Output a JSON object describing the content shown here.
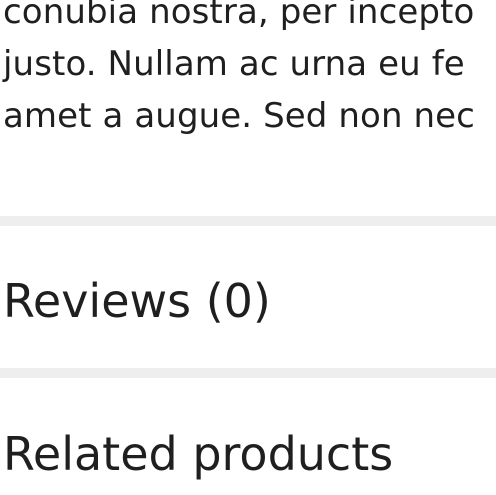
{
  "description": {
    "lines": [
      "conubia nostra, per incepto",
      "justo. Nullam ac urna eu fe",
      "amet a augue. Sed non nec"
    ]
  },
  "sections": {
    "reviews_heading": "Reviews (0)",
    "related_heading": "Related products"
  },
  "colors": {
    "text": "#1f1f1f",
    "separator": "#eeeeee",
    "background": "#ffffff"
  }
}
